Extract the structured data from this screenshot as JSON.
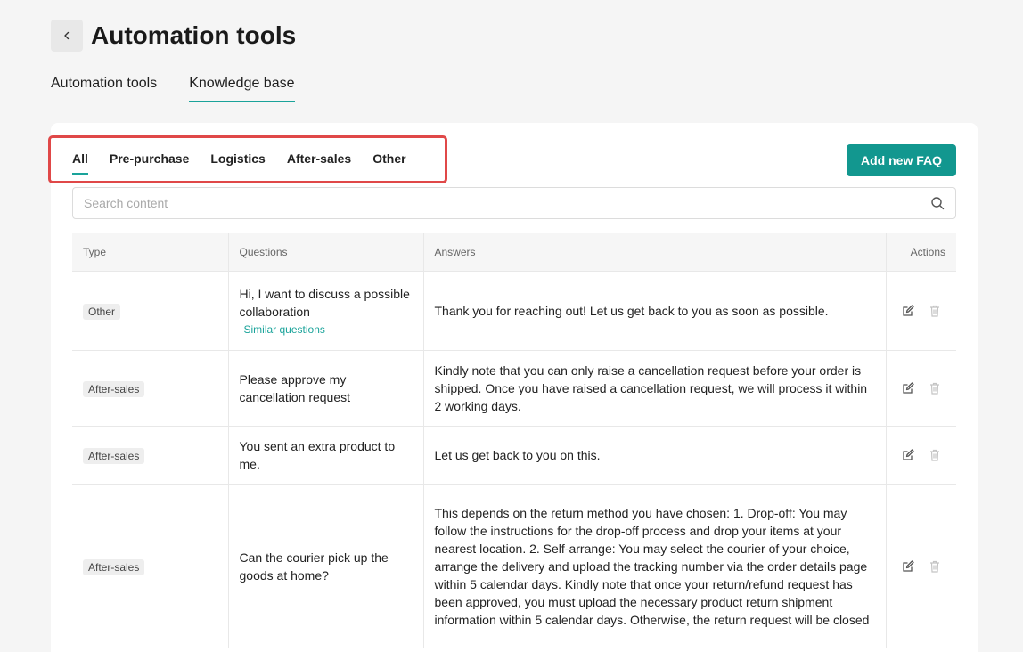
{
  "header": {
    "title": "Automation tools"
  },
  "main_tabs": [
    {
      "label": "Automation tools",
      "active": false
    },
    {
      "label": "Knowledge base",
      "active": true
    }
  ],
  "filter_tabs": [
    {
      "label": "All",
      "active": true
    },
    {
      "label": "Pre-purchase",
      "active": false
    },
    {
      "label": "Logistics",
      "active": false
    },
    {
      "label": "After-sales",
      "active": false
    },
    {
      "label": "Other",
      "active": false
    }
  ],
  "add_button_label": "Add new FAQ",
  "search": {
    "placeholder": "Search content"
  },
  "table": {
    "headers": [
      "Type",
      "Questions",
      "Answers",
      "Actions"
    ],
    "rows": [
      {
        "type": "Other",
        "question": "Hi, I want to discuss a possible collaboration",
        "similar": "Similar questions",
        "answer": "Thank you for reaching out! Let us get back to you as soon as possible."
      },
      {
        "type": "After-sales",
        "question": "Please approve my cancellation request",
        "answer": "Kindly note that you can only raise a cancellation request before your order is shipped. Once you have raised a cancellation request, we will process it within 2 working days."
      },
      {
        "type": "After-sales",
        "question": "You sent an extra product to me.",
        "answer": "Let us get back to you on this."
      },
      {
        "type": "After-sales",
        "question": "Can the courier pick up the goods at home?",
        "answer": "This depends on the return method you have chosen: 1. Drop-off: You may follow the instructions for the drop-off process and drop your items at your nearest location. 2. Self-arrange: You may select the courier of your choice, arrange the delivery and upload the tracking number via the order details page within 5 calendar days. Kindly note that once your return/refund request has been approved, you must upload the necessary product return shipment information within 5 calendar days. Otherwise, the return request will be closed"
      }
    ]
  },
  "colors": {
    "accent": "#12978f",
    "highlight_border": "#e04848"
  }
}
